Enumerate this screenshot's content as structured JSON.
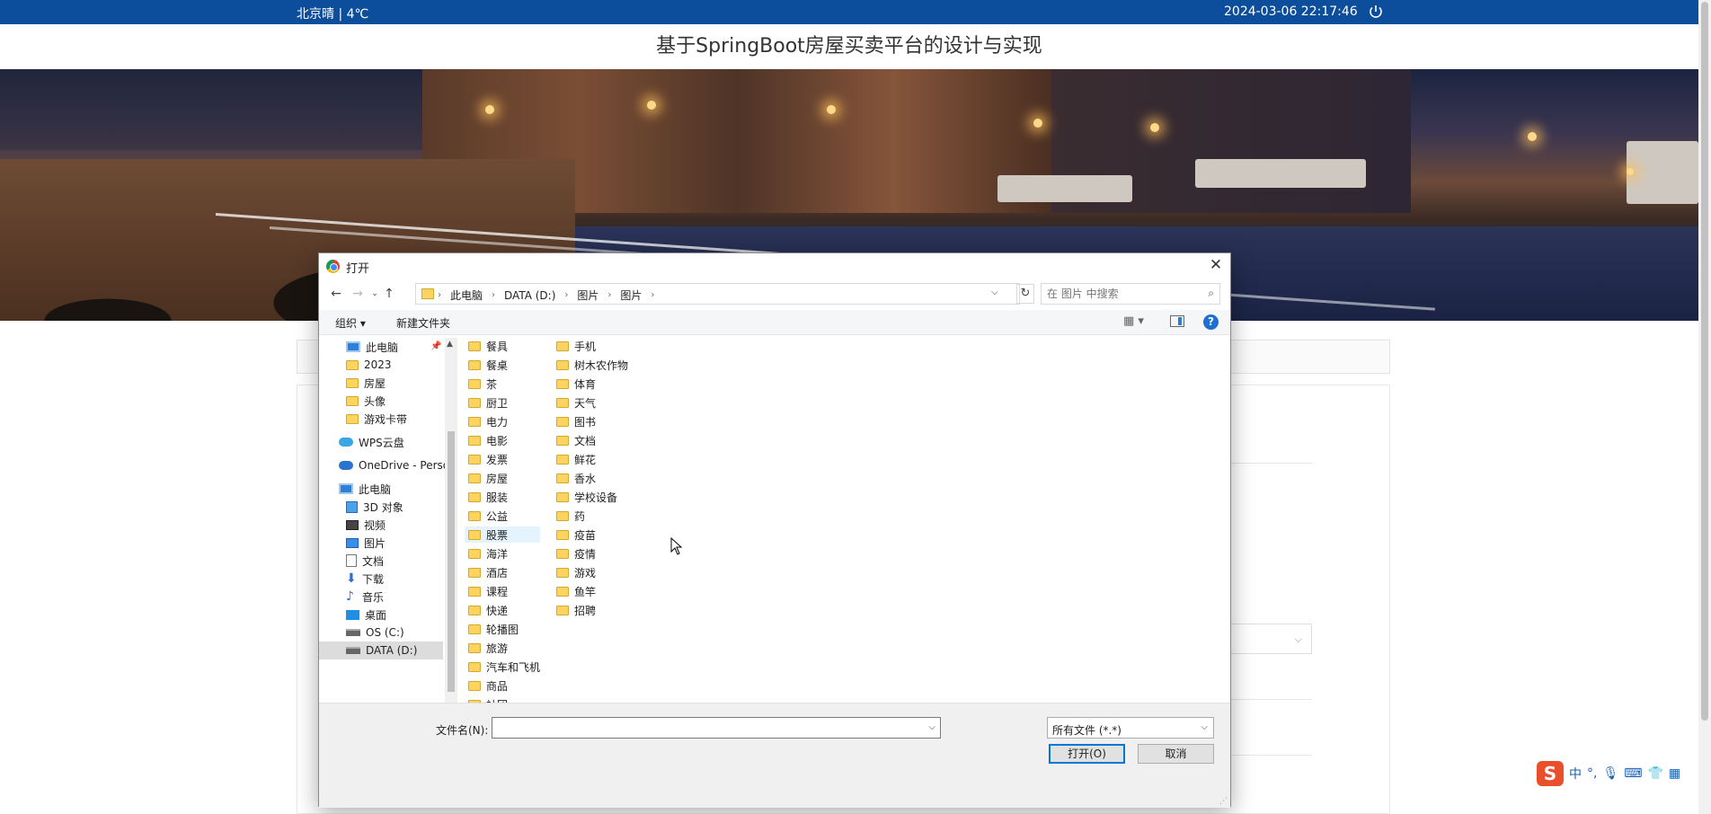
{
  "topbar": {
    "weather": "北京晴 | 4℃",
    "datetime": "2024-03-06   22:17:46",
    "power_icon": "power-icon"
  },
  "site": {
    "title": "基于SpringBoot房屋买卖平台的设计与实现"
  },
  "dialog": {
    "title": "打开",
    "breadcrumbs": [
      "此电脑",
      "DATA (D:)",
      "图片",
      "图片"
    ],
    "search_placeholder": "在 图片 中搜索",
    "toolbar": {
      "organize": "组织 ▾",
      "new_folder": "新建文件夹"
    },
    "nav_items": [
      {
        "label": "此电脑",
        "icon": "pc-icon"
      },
      {
        "label": "2023",
        "icon": "folder-icon"
      },
      {
        "label": "房屋",
        "icon": "folder-icon"
      },
      {
        "label": "头像",
        "icon": "folder-icon"
      },
      {
        "label": "游戏卡带",
        "icon": "folder-icon"
      },
      {
        "label": "WPS云盘",
        "icon": "cloud-icon"
      },
      {
        "label": "OneDrive - Perso",
        "icon": "onedrive-icon"
      },
      {
        "label": "此电脑",
        "icon": "pc-icon"
      },
      {
        "label": "3D 对象",
        "icon": "cube-icon"
      },
      {
        "label": "视频",
        "icon": "video-icon"
      },
      {
        "label": "图片",
        "icon": "pictures-icon"
      },
      {
        "label": "文档",
        "icon": "document-icon"
      },
      {
        "label": "下载",
        "icon": "download-icon"
      },
      {
        "label": "音乐",
        "icon": "music-icon"
      },
      {
        "label": "桌面",
        "icon": "desktop-icon"
      },
      {
        "label": "OS (C:)",
        "icon": "drive-icon"
      },
      {
        "label": "DATA (D:)",
        "icon": "drive-icon"
      }
    ],
    "folders_col1": [
      "餐具",
      "餐桌",
      "茶",
      "厨卫",
      "电力",
      "电影",
      "发票",
      "房屋",
      "服装",
      "公益",
      "股票",
      "海洋",
      "酒店",
      "课程",
      "快递",
      "轮播图",
      "旅游",
      "汽车和飞机",
      "商品",
      "社团"
    ],
    "folders_col2": [
      "手机",
      "树木农作物",
      "体育",
      "天气",
      "图书",
      "文档",
      "鲜花",
      "香水",
      "学校设备",
      "药",
      "疫苗",
      "疫情",
      "游戏",
      "鱼竿",
      "招聘"
    ],
    "filename_label": "文件名(N):",
    "filename_value": "",
    "filetype": "所有文件 (*.*)",
    "open_button": "打开(O)",
    "cancel_button": "取消"
  },
  "ime": {
    "logo": "S",
    "mode": "中"
  }
}
